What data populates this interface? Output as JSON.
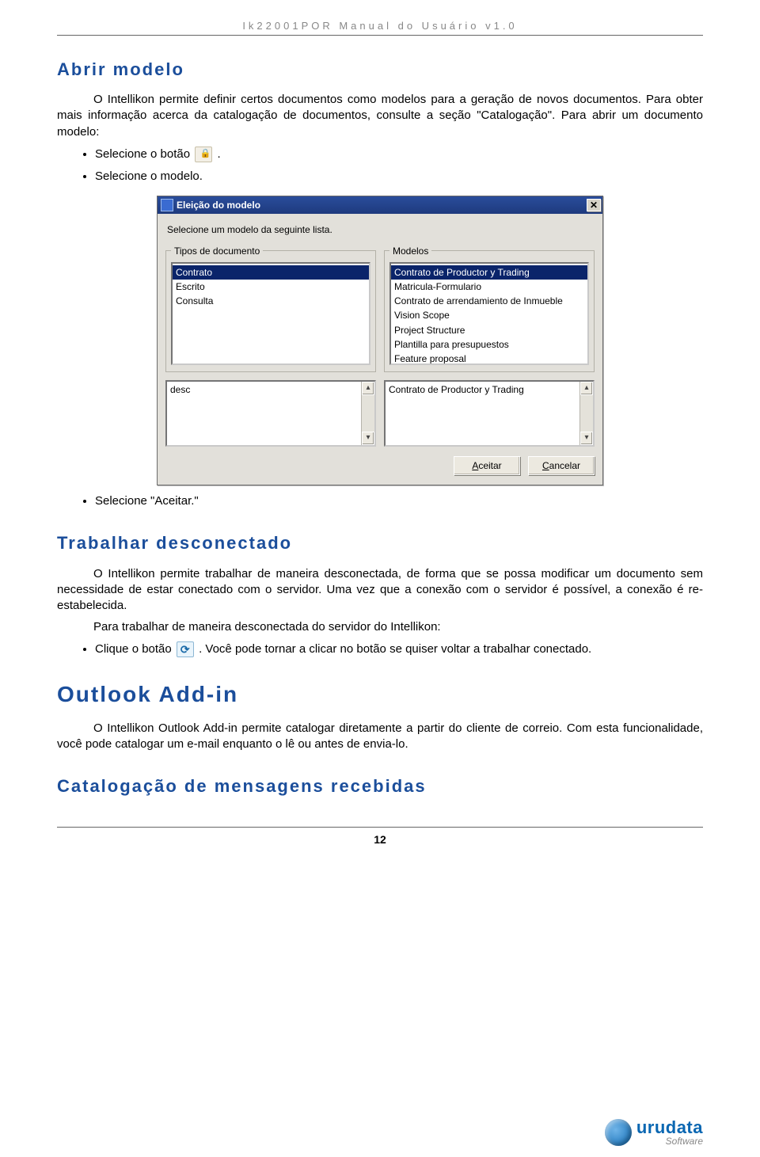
{
  "header": "Ik22001POR Manual do Usuário v1.0",
  "section1": {
    "title": "Abrir modelo",
    "para": "O Intellikon permite definir certos documentos como modelos para a geração de novos documentos. Para obter mais informação acerca da catalogação de documentos, consulte a seção \"Catalogação\". Para abrir um documento modelo:",
    "b1_pre": "Selecione o botão ",
    "b1_post": ".",
    "b2": "Selecione o modelo.",
    "b3": "Selecione \"Aceitar.\""
  },
  "dialog": {
    "title": "Eleição do modelo",
    "prompt": "Selecione um modelo da seguinte lista.",
    "tipos_legend": "Tipos de documento",
    "modelos_legend": "Modelos",
    "tipos": [
      "Contrato",
      "Escrito",
      "Consulta"
    ],
    "modelos": [
      "Contrato de Productor y Trading",
      "Matricula-Formulario",
      "Contrato de arrendamiento de Inmueble",
      "Vision Scope",
      "Project Structure",
      "Plantilla para presupuestos",
      "Feature proposal"
    ],
    "desc_left": "desc",
    "desc_right": "Contrato de Productor y Trading",
    "aceitar": "Aceitar",
    "cancelar": "Cancelar"
  },
  "section2": {
    "title": "Trabalhar desconectado",
    "para1": "O Intellikon permite trabalhar de maneira desconectada, de forma que se possa modificar um documento sem necessidade de estar conectado com o servidor. Uma vez que a conexão com o servidor é possível, a conexão é re-estabelecida.",
    "para2": "Para trabalhar de maneira desconectada do servidor do Intellikon:",
    "b1_pre": "Clique o botão ",
    "b1_post": ". Você pode tornar a clicar no botão se quiser voltar a trabalhar conectado."
  },
  "section3": {
    "title": "Outlook Add-in",
    "para": "O Intellikon Outlook Add-in permite catalogar diretamente a partir do cliente de correio. Com esta funcionalidade, você pode catalogar um e-mail enquanto o lê ou antes de envia-lo."
  },
  "section4": {
    "title": "Catalogação de mensagens recebidas"
  },
  "footer": {
    "page": "12",
    "brand": "urudata",
    "brand_sub": "Software"
  }
}
